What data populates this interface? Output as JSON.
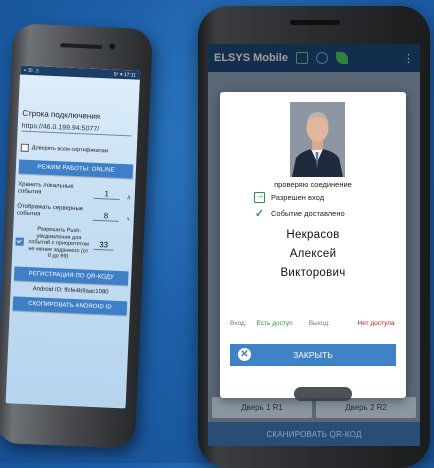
{
  "left_phone": {
    "status_bar": {
      "left": "▪ ☏ ⚠",
      "right": "5⁵ ▾ 17:11"
    },
    "connection_label": "Строка подключения",
    "connection_url": "https://46.0.199.94:5077/",
    "trust_label": "Доверять всем сертификатам",
    "mode_button": "РЕЖИМ РАБОТЫ: ONLINE",
    "local_events_label": "Хранить локальные события",
    "local_events_value": "1",
    "local_events_unit": "д.",
    "server_events_label": "Отображать серверные события",
    "server_events_value": "8",
    "server_events_unit": "ч.",
    "push_label": "Разрешить Push-уведомления для событий с приоритетом не менее заданного (от 0 до 99)",
    "push_value": "33",
    "qr_register_button": "РЕГИСТРАЦИЯ ПО QR-КОДУ",
    "android_id": "Android ID: ffcfe4b9aac1080",
    "copy_button": "СКОПИРОВАТЬ ANDROID ID"
  },
  "right_phone": {
    "app_title": "ELSYS Mobile",
    "menu_glyph": "⋮",
    "dialog": {
      "checking": "проверяю соединение",
      "entry_allowed": "Разрешен вход",
      "event_delivered": "Событие доставлено",
      "last_name": "Некрасов",
      "first_name": "Алексей",
      "patronymic": "Викторович",
      "entry_key": "Вход:",
      "entry_value": "Есть доступ",
      "exit_key": "Выход:",
      "exit_value": "Нет доступа",
      "close_button": "ЗАКРЫТЬ"
    },
    "door1": "Дверь 1 R1",
    "door2": "Дверь 2 R2",
    "scan_button": "СКАНИРОВАТЬ QR-КОД",
    "colors": {
      "appbar": "#1d4a7a",
      "button": "#3f82c6",
      "success": "#2c9a3a",
      "error": "#d01818"
    }
  }
}
